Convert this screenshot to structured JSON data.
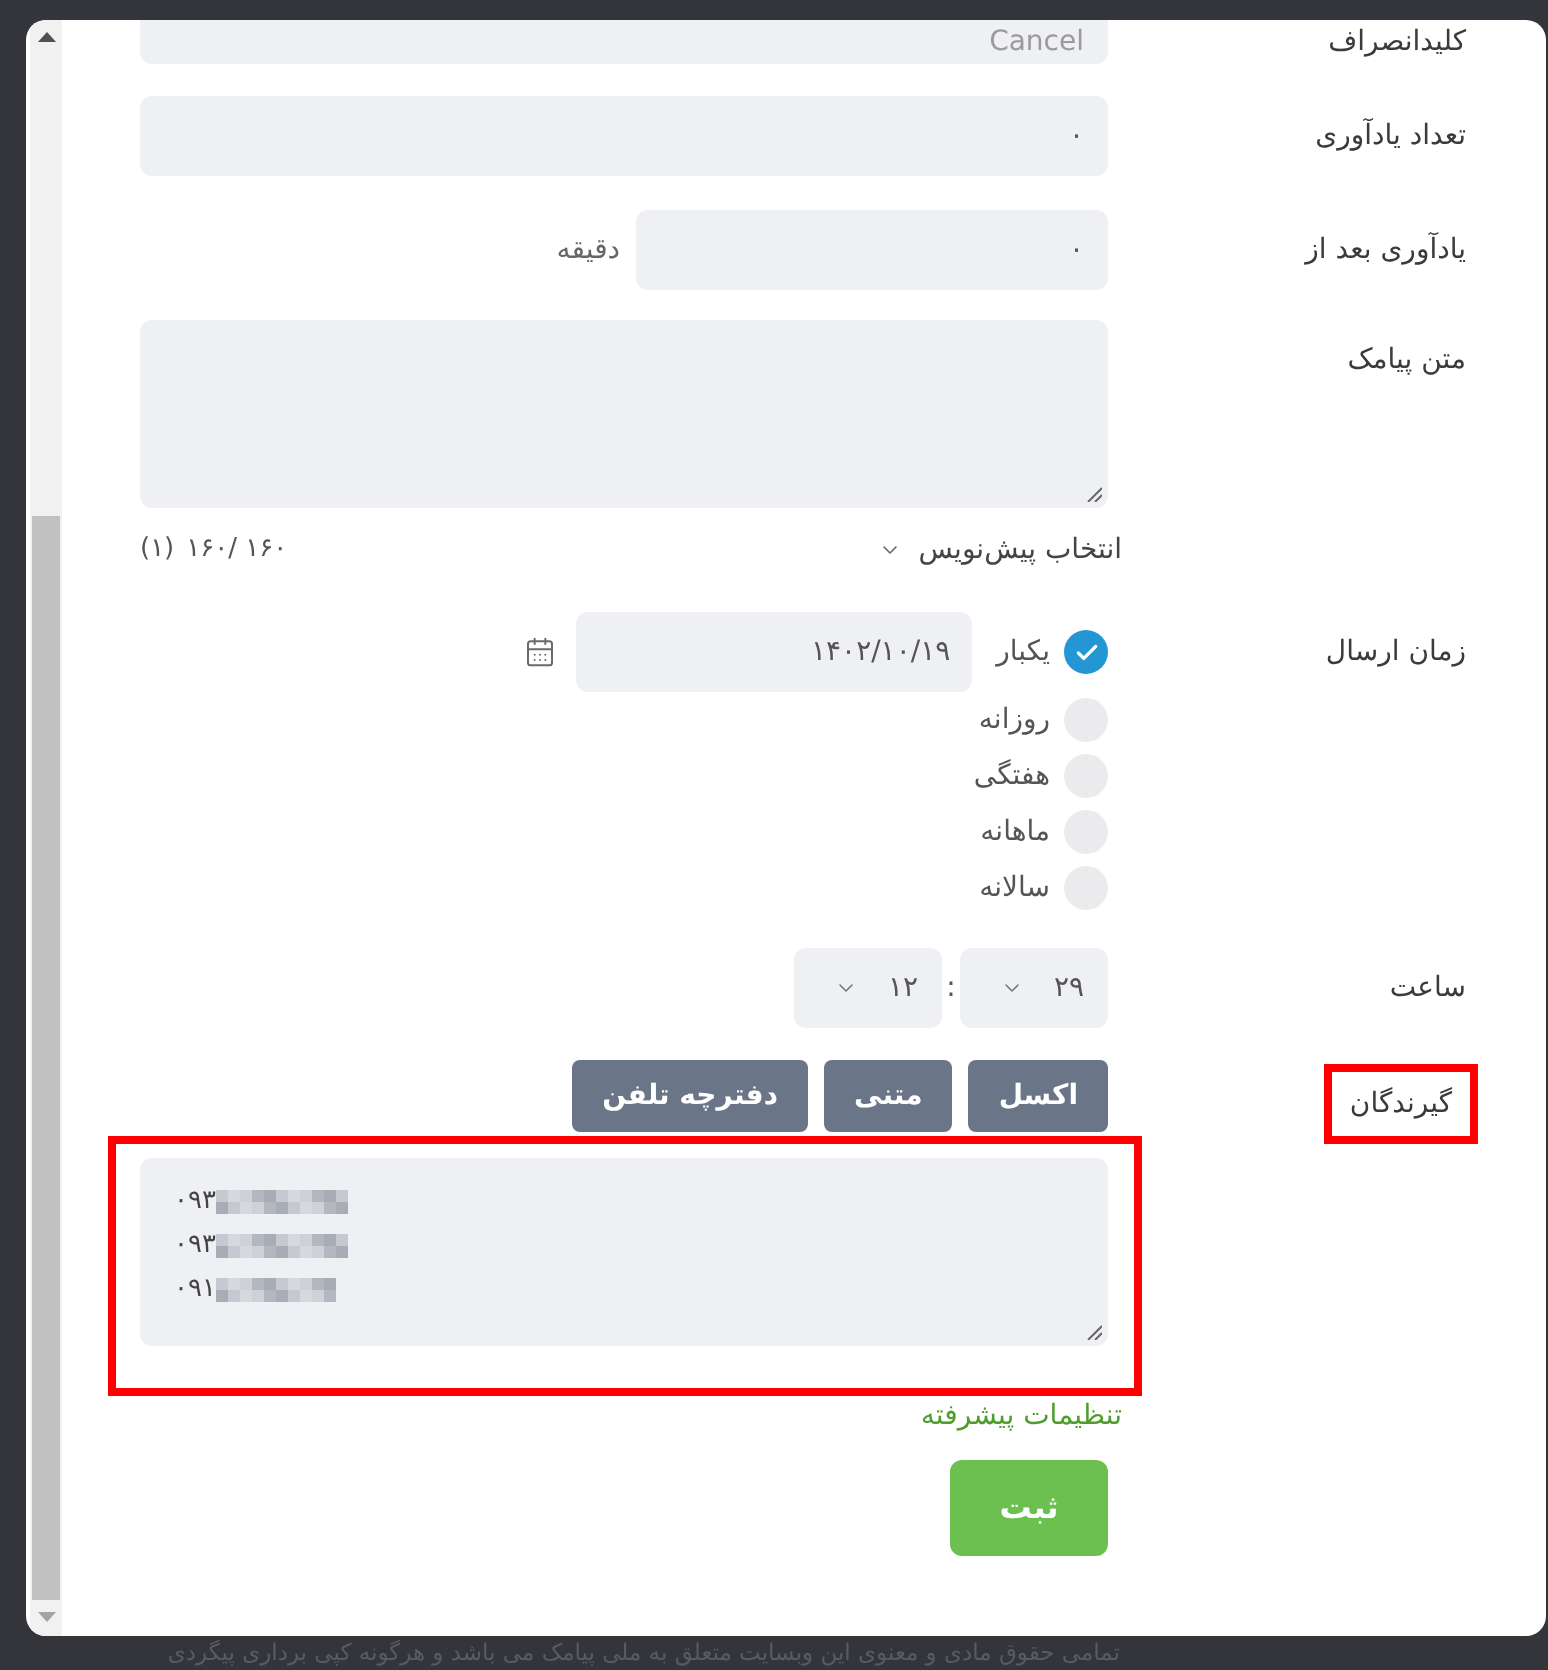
{
  "form": {
    "cancel_key": {
      "label": "کلیدانصراف",
      "placeholder": "Cancel"
    },
    "reminder_count": {
      "label": "تعداد یادآوری",
      "value": "۰"
    },
    "reminder_after": {
      "label": "یادآوری بعد از",
      "value": "۰",
      "unit": "دقیقه"
    },
    "message": {
      "label": "متن پیامک",
      "draft_select": "انتخاب پیش‌نویس",
      "char_counter": "۱۶۰/ ۱۶۰",
      "sms_count": "(۱)"
    },
    "send_time": {
      "label": "زمان ارسال",
      "options": [
        {
          "label": "یکبار",
          "selected": true,
          "date": "۱۴۰۲/۱۰/۱۹"
        },
        {
          "label": "روزانه",
          "selected": false
        },
        {
          "label": "هفتگی",
          "selected": false
        },
        {
          "label": "ماهانه",
          "selected": false
        },
        {
          "label": "سالانه",
          "selected": false
        }
      ]
    },
    "clock": {
      "label": "ساعت",
      "fields": [
        {
          "value": "۲۹"
        },
        {
          "value": "۱۲"
        }
      ],
      "separator": ":"
    },
    "recipients": {
      "label": "گیرندگان",
      "label_highlighted": true,
      "buttons": [
        "اکسل",
        "متنی",
        "دفترچه تلفن"
      ],
      "numbers": [
        {
          "text": "۰۹۳",
          "redacted": true
        },
        {
          "text": "۰۹۳",
          "redacted": true
        },
        {
          "text": "۰۹۱",
          "redacted": true
        }
      ],
      "numbers_highlighted": true
    },
    "advanced_link": "تنظیمات پیشرفته",
    "submit": "ثبت"
  },
  "footer": {
    "copyright": "تمامی حقوق مادی و معنوی این وبسایت متعلق به ملی پیامک می باشد و هرگونه کپی برداری پیگردی"
  }
}
